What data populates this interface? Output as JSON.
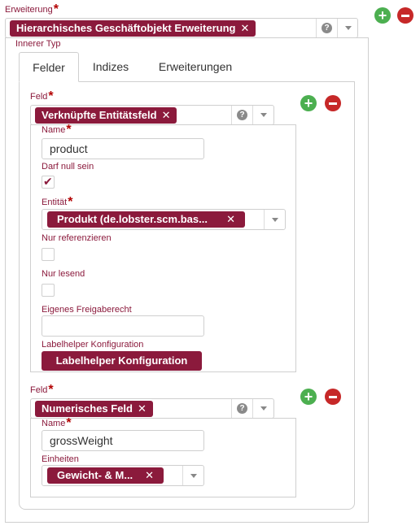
{
  "erweiterung": {
    "label": "Erweiterung",
    "required_mark": "*",
    "tag": "Hierarchisches Geschäftobjekt Erweiterung",
    "tag_remove": "✕",
    "help": "?"
  },
  "inner_type": {
    "label": "Innerer Typ"
  },
  "tabs": [
    {
      "label": "Felder",
      "active": true
    },
    {
      "label": "Indizes",
      "active": false
    },
    {
      "label": "Erweiterungen",
      "active": false
    }
  ],
  "field1": {
    "label": "Feld",
    "required_mark": "*",
    "tag": "Verknüpfte Entitätsfeld",
    "tag_remove": "✕",
    "help": "?",
    "name_label": "Name",
    "name_value": "product",
    "nullable_label": "Darf null sein",
    "nullable_checked": true,
    "entity_label": "Entität",
    "entity_tag": "Produkt (de.lobster.scm.bas...",
    "entity_remove": "✕",
    "ref_only_label": "Nur referenzieren",
    "readonly_label": "Nur lesend",
    "own_permission_label": "Eigenes Freigaberecht",
    "own_permission_value": "",
    "labelhelper_label": "Labelhelper Konfiguration",
    "labelhelper_button": "Labelhelper Konfiguration"
  },
  "field2": {
    "label": "Feld",
    "required_mark": "*",
    "tag": "Numerisches Feld",
    "tag_remove": "✕",
    "help": "?",
    "name_label": "Name",
    "name_value": "grossWeight",
    "units_label": "Einheiten",
    "units_tag": "Gewicht- & M...",
    "units_remove": "✕"
  },
  "icons": {
    "add": "+",
    "check": "✔"
  },
  "colors": {
    "accent": "#8b1a3c",
    "add": "#4caf50",
    "remove": "#c62828"
  }
}
